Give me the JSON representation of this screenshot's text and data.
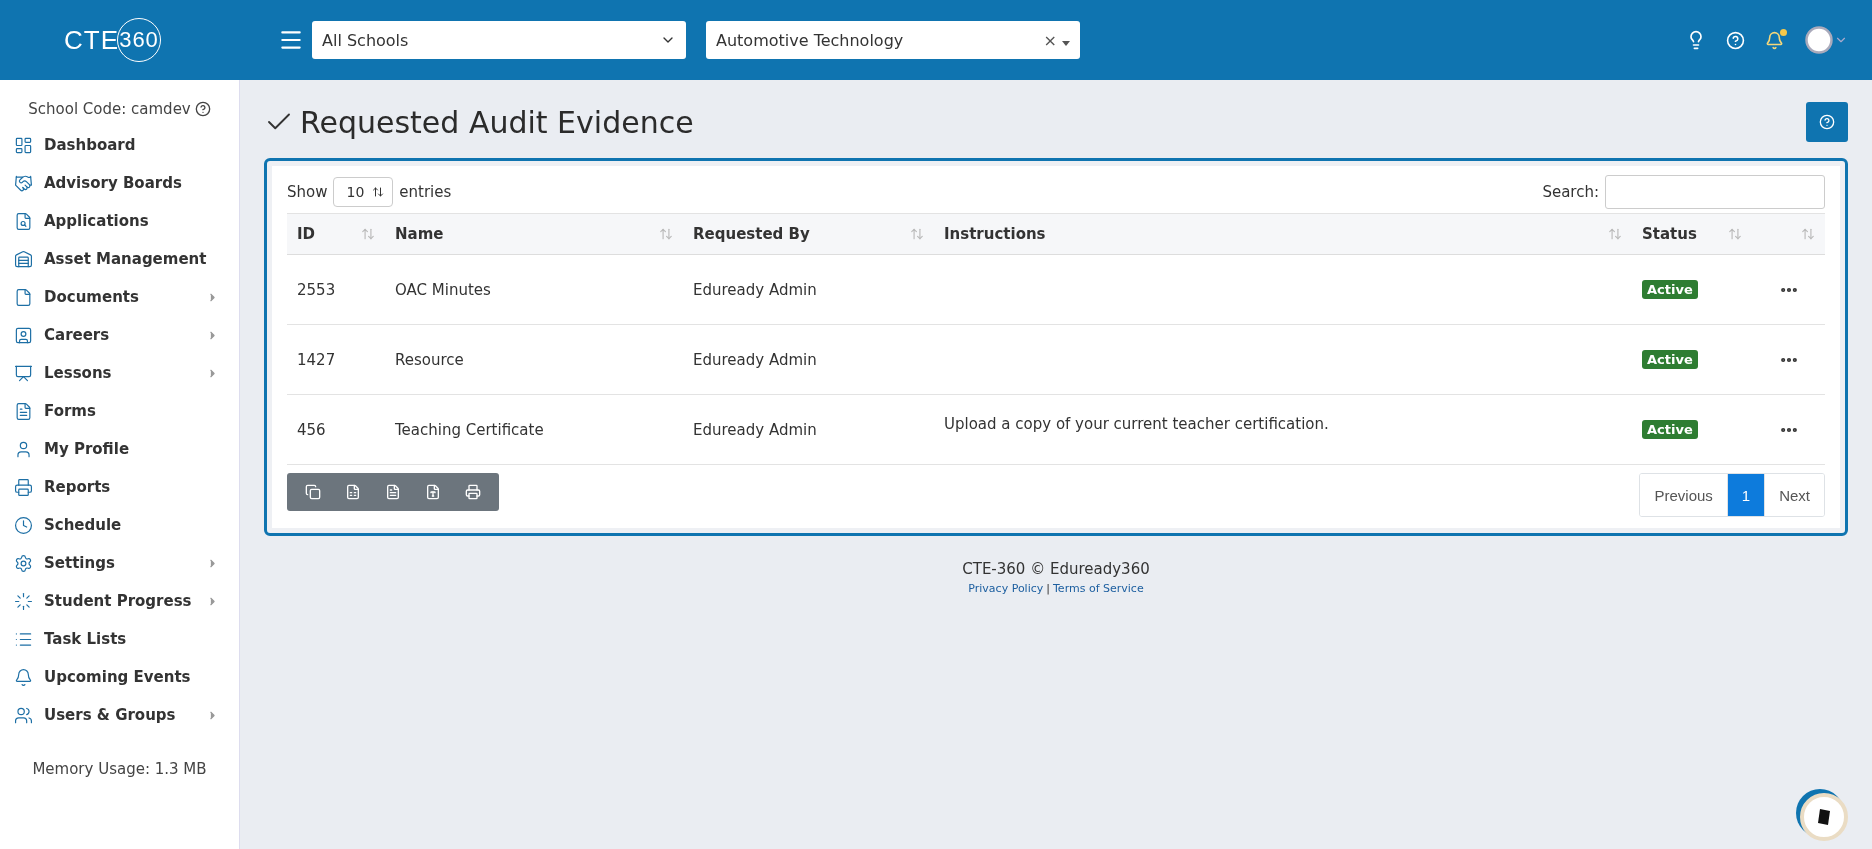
{
  "header": {
    "logo": {
      "prefix": "CTE",
      "circled": "360"
    },
    "school_select": {
      "value": "All Schools"
    },
    "program_select": {
      "value": "Automotive Technology",
      "clear": "×"
    },
    "notifications": {
      "unread": true
    }
  },
  "sidebar": {
    "school_code": "School Code: camdev",
    "items": [
      {
        "label": "Dashboard",
        "expandable": false
      },
      {
        "label": "Advisory Boards",
        "expandable": false
      },
      {
        "label": "Applications",
        "expandable": false
      },
      {
        "label": "Asset Management",
        "expandable": false
      },
      {
        "label": "Documents",
        "expandable": true
      },
      {
        "label": "Careers",
        "expandable": true
      },
      {
        "label": "Lessons",
        "expandable": true
      },
      {
        "label": "Forms",
        "expandable": false
      },
      {
        "label": "My Profile",
        "expandable": false
      },
      {
        "label": "Reports",
        "expandable": false
      },
      {
        "label": "Schedule",
        "expandable": false
      },
      {
        "label": "Settings",
        "expandable": true
      },
      {
        "label": "Student Progress",
        "expandable": true
      },
      {
        "label": "Task Lists",
        "expandable": false
      },
      {
        "label": "Upcoming Events",
        "expandable": false
      },
      {
        "label": "Users & Groups",
        "expandable": true
      }
    ],
    "memory_usage": "Memory Usage: 1.3 MB"
  },
  "page": {
    "title": "Requested Audit Evidence"
  },
  "table": {
    "show_label": "Show",
    "page_size": "10",
    "entries_label": "entries",
    "search_label": "Search:",
    "columns": [
      {
        "label": "ID"
      },
      {
        "label": "Name"
      },
      {
        "label": "Requested By"
      },
      {
        "label": "Instructions"
      },
      {
        "label": "Status"
      }
    ],
    "rows": [
      {
        "id": "2553",
        "name": "OAC Minutes",
        "requested_by": "Eduready Admin",
        "status": "Active",
        "color": "#2e7d32"
      },
      {
        "id": "1427",
        "name": "Resource",
        "requested_by": "Eduready Admin",
        "status": "Active",
        "color": "#2e7d32"
      },
      {
        "id": "456",
        "name": "Teaching Certificate",
        "requested_by": "Eduready Admin",
        "instructions": "Upload a copy of your current teacher certification.",
        "status": "Active",
        "color": "#2e7d32"
      }
    ],
    "pagination": {
      "previous": "Previous",
      "next": "Next",
      "pages": [
        {
          "label": "1",
          "selected": true
        }
      ]
    }
  },
  "footer": {
    "copyright": "CTE-360 © Eduready360",
    "privacy": "Privacy Policy",
    "separator": "|",
    "terms": "Terms of Service"
  }
}
